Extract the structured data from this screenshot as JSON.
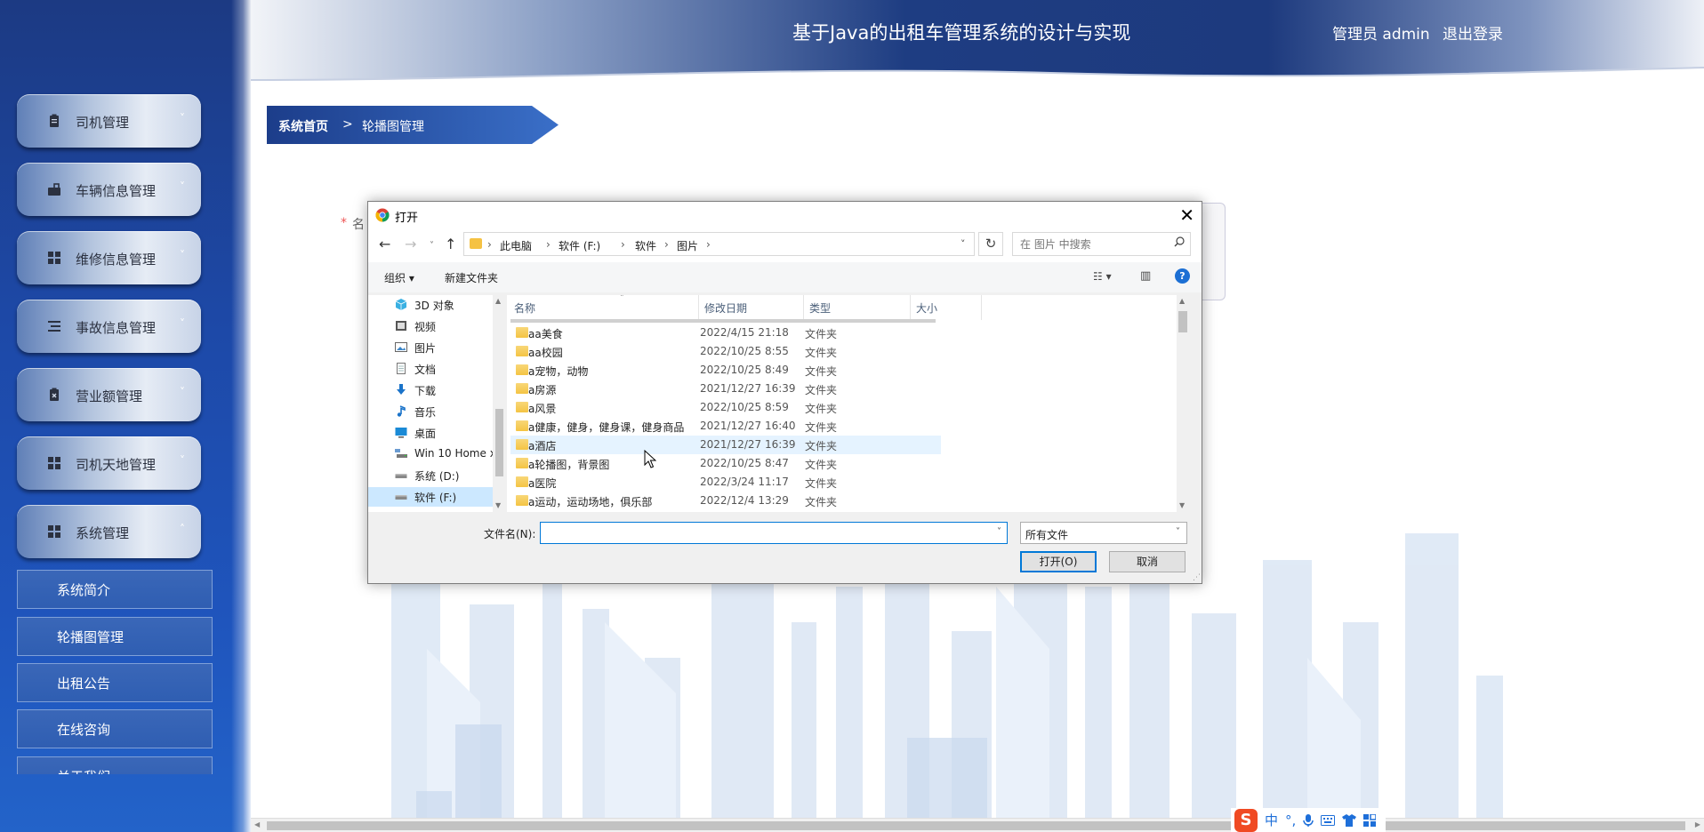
{
  "header": {
    "title": "基于Java的出租车管理系统的设计与实现",
    "admin_label": "管理员 admin",
    "logout": "退出登录"
  },
  "sidebar": {
    "items": [
      {
        "label": "司机管理",
        "icon": "clipboard-icon",
        "chevron": "˅"
      },
      {
        "label": "车辆信息管理",
        "icon": "briefcase-icon",
        "chevron": "˅"
      },
      {
        "label": "维修信息管理",
        "icon": "grid-icon",
        "chevron": "˅"
      },
      {
        "label": "事故信息管理",
        "icon": "list-icon",
        "chevron": "˅"
      },
      {
        "label": "营业额管理",
        "icon": "clipboard-x-icon",
        "chevron": "˅"
      },
      {
        "label": "司机天地管理",
        "icon": "grid-icon",
        "chevron": "˅"
      },
      {
        "label": "系统管理",
        "icon": "grid-icon",
        "chevron": "˄"
      }
    ],
    "sub_items": [
      {
        "label": "系统简介"
      },
      {
        "label": "轮播图管理"
      },
      {
        "label": "出租公告"
      },
      {
        "label": "在线咨询"
      },
      {
        "label": "关于我们"
      }
    ]
  },
  "breadcrumb": {
    "home": "系统首页",
    "separator": ">",
    "current": "轮播图管理"
  },
  "form": {
    "required_mark": "*",
    "label_partial": "名"
  },
  "dialog": {
    "title": "打开",
    "close": "✕",
    "address_path": [
      "此电脑",
      "软件 (F:)",
      "软件",
      "图片"
    ],
    "search_placeholder": "在 图片 中搜索",
    "toolbar": {
      "organize": "组织 ▾",
      "new_folder": "新建文件夹"
    },
    "tree": [
      {
        "label": "3D 对象",
        "icon": "cube-icon"
      },
      {
        "label": "视频",
        "icon": "video-icon"
      },
      {
        "label": "图片",
        "icon": "picture-icon"
      },
      {
        "label": "文档",
        "icon": "document-icon"
      },
      {
        "label": "下载",
        "icon": "download-icon"
      },
      {
        "label": "音乐",
        "icon": "music-icon"
      },
      {
        "label": "桌面",
        "icon": "desktop-icon"
      },
      {
        "label": "Win 10 Home x",
        "icon": "network-drive-icon"
      },
      {
        "label": "系统 (D:)",
        "icon": "drive-icon"
      },
      {
        "label": "软件 (F:)",
        "icon": "drive-icon",
        "selected": true
      }
    ],
    "columns": {
      "name": "名称",
      "date": "修改日期",
      "type": "类型",
      "size": "大小"
    },
    "files": [
      {
        "name": "aa美食",
        "date": "2022/4/15 21:18",
        "type": "文件夹"
      },
      {
        "name": "aa校园",
        "date": "2022/10/25 8:55",
        "type": "文件夹"
      },
      {
        "name": "a宠物，动物",
        "date": "2022/10/25 8:49",
        "type": "文件夹"
      },
      {
        "name": "a房源",
        "date": "2021/12/27 16:39",
        "type": "文件夹"
      },
      {
        "name": "a风景",
        "date": "2022/10/25 8:59",
        "type": "文件夹"
      },
      {
        "name": "a健康，健身，健身课，健身商品",
        "date": "2021/12/27 16:40",
        "type": "文件夹"
      },
      {
        "name": "a酒店",
        "date": "2021/12/27 16:39",
        "type": "文件夹",
        "hover": true
      },
      {
        "name": "a轮播图，背景图",
        "date": "2022/10/25 8:47",
        "type": "文件夹"
      },
      {
        "name": "a医院",
        "date": "2022/3/24 11:17",
        "type": "文件夹"
      },
      {
        "name": "a运动，运动场地，俱乐部",
        "date": "2022/12/4 13:29",
        "type": "文件夹"
      }
    ],
    "filename_label": "文件名(N):",
    "filename_value": "",
    "filetype": "所有文件",
    "open_button": "打开(O)",
    "cancel_button": "取消"
  },
  "ime": {
    "logo": "S",
    "mode": "中",
    "punct": "°,",
    "icons": [
      "mic-icon",
      "keyboard-icon",
      "shirt-icon",
      "apps-icon"
    ]
  },
  "colors": {
    "sidebar": "#1f4aa6",
    "accent": "#0078d7",
    "breadcrumb": "#1c3d8a"
  }
}
